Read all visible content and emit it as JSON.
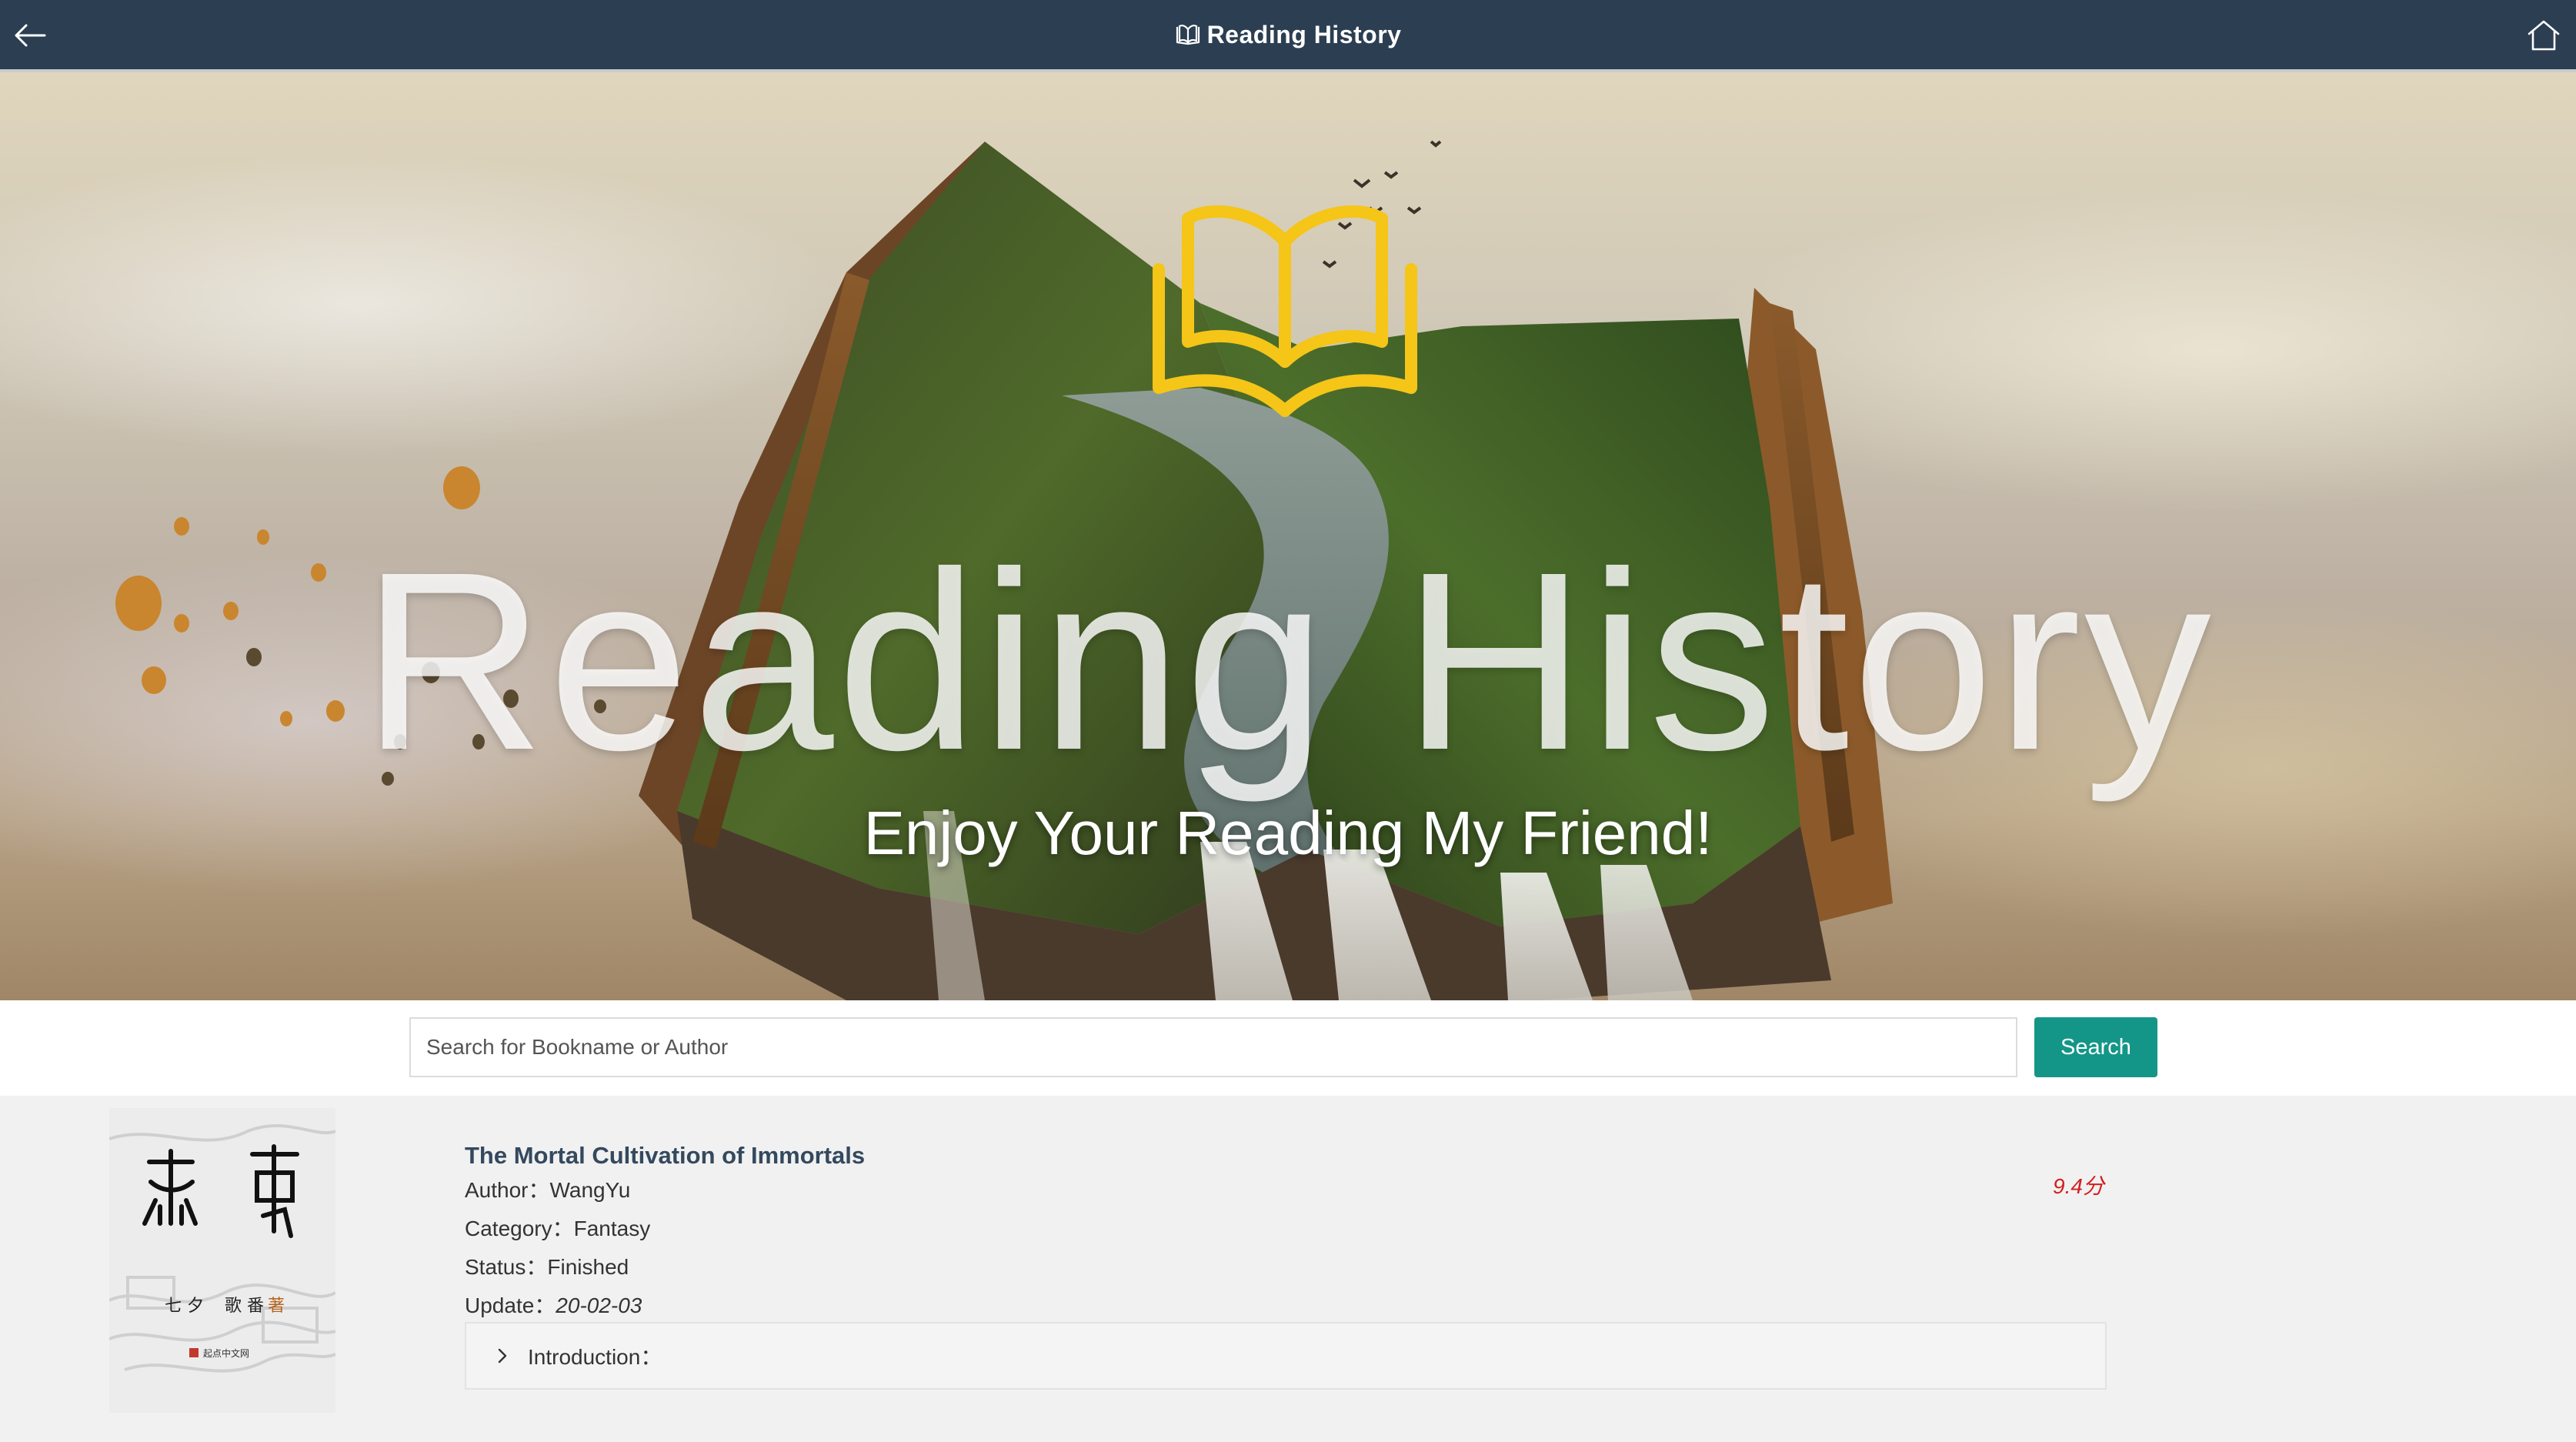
{
  "navbar": {
    "title": "Reading History",
    "back_icon": "arrow-left-icon",
    "home_icon": "home-icon",
    "title_icon": "book-open-icon",
    "background": "#2c3e52"
  },
  "hero": {
    "title": "Reading History",
    "subtitle": "Enjoy Your Reading My Friend!",
    "logo_icon": "open-book-icon",
    "logo_color": "#f5c518"
  },
  "search": {
    "placeholder": "Search for Bookname or Author",
    "value": "",
    "button_label": "Search",
    "button_color": "#139688"
  },
  "books": [
    {
      "title": "The Mortal Cultivation of Immortals",
      "author_label": "Author：",
      "author": "WangYu",
      "category_label": "Category：",
      "category": "Fantasy",
      "status_label": "Status：",
      "status": "Finished",
      "update_label": "Update：",
      "update": "20-02-03",
      "rating": "9.4分",
      "introduction_label": "Introduction：",
      "introduction_expanded": false,
      "cover": {
        "large_glyphs": "凡 人",
        "caption": "七 夕 歌 番 著",
        "publisher": "起点中文网"
      }
    }
  ]
}
